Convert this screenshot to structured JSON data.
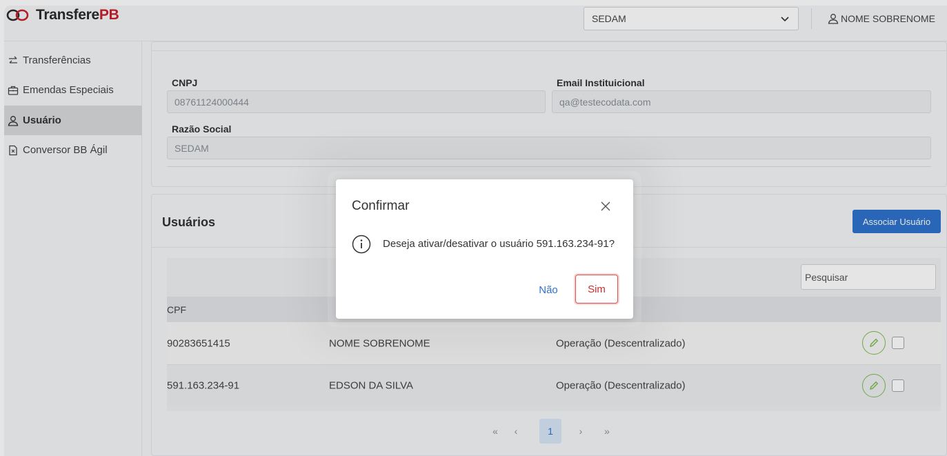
{
  "app": {
    "brand_prefix": "Transfere",
    "brand_suffix": "PB",
    "brand_color": "#c9202b"
  },
  "header": {
    "org_select_value": "SEDAM",
    "user_name": "NOME SOBRENOME"
  },
  "sidebar": {
    "items": [
      {
        "label": "Transferências",
        "icon": "transfer-arrows-icon",
        "active": false
      },
      {
        "label": "Emendas Especiais",
        "icon": "briefcase-icon",
        "active": false
      },
      {
        "label": "Usuário",
        "icon": "user-icon",
        "active": true
      },
      {
        "label": "Conversor BB Ágil",
        "icon": "document-icon",
        "active": false
      }
    ]
  },
  "org_form": {
    "cnpj_label": "CNPJ",
    "cnpj_value": "08761124000444",
    "email_label": "Email Instituicional",
    "email_value": "qa@testecodata.com",
    "razao_label": "Razão Social",
    "razao_value": "SEDAM"
  },
  "users": {
    "title": "Usuários",
    "associate_button": "Associar Usuário",
    "search_placeholder": "Pesquisar",
    "columns": [
      "CPF"
    ],
    "rows": [
      {
        "cpf": "90283651415",
        "name": "NOME SOBRENOME",
        "role": "Operação (Descentralizado)"
      },
      {
        "cpf": "591.163.234-91",
        "name": "EDSON DA SILVA",
        "role": "Operação (Descentralizado)"
      }
    ],
    "pagination": {
      "first": "«",
      "prev": "‹",
      "current": "1",
      "next": "›",
      "last": "»"
    }
  },
  "dialog": {
    "title": "Confirmar",
    "message": "Deseja ativar/desativar o usuário 591.163.234-91?",
    "no_label": "Não",
    "yes_label": "Sim"
  },
  "colors": {
    "primary": "#2e72cc",
    "danger": "#d9534f",
    "success": "#7cba4e"
  }
}
